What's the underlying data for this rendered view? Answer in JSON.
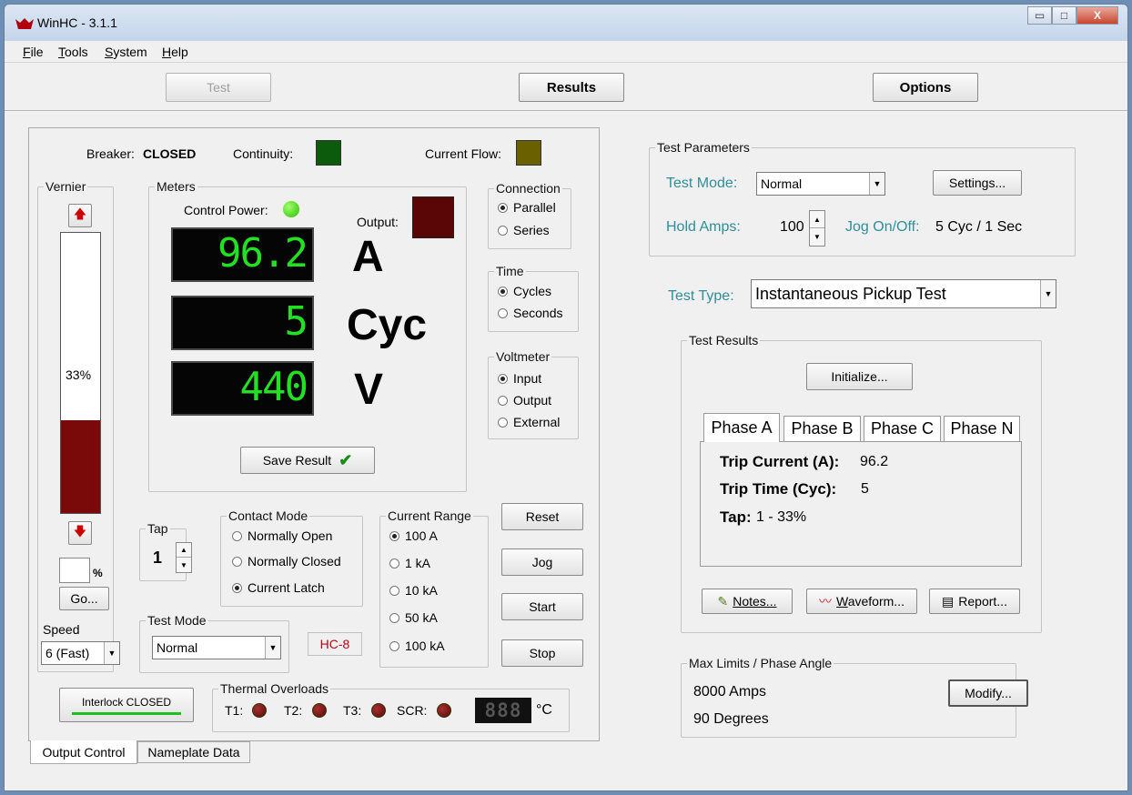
{
  "window": {
    "title": "WinHC - 3.1.1",
    "min": "▭",
    "max": "□",
    "close": "X"
  },
  "menu": {
    "items": [
      {
        "u": "F",
        "rest": "ile"
      },
      {
        "u": "T",
        "rest": "ools"
      },
      {
        "u": "S",
        "rest": "ystem"
      },
      {
        "u": "H",
        "rest": "elp"
      }
    ]
  },
  "toolbar": {
    "test": "Test",
    "results": "Results",
    "options": "Options"
  },
  "status": {
    "breaker_label": "Breaker:",
    "breaker_value": "CLOSED",
    "continuity_label": "Continuity:",
    "current_flow_label": "Current Flow:"
  },
  "vernier": {
    "label": "Vernier",
    "percent": "33%",
    "level": 0.33,
    "pct_unit": "%",
    "go": "Go...",
    "speed_label": "Speed",
    "speed_value": "6 (Fast)"
  },
  "meters": {
    "label": "Meters",
    "control_power": "Control Power:",
    "output": "Output:",
    "amps": "96.2",
    "amps_unit": "A",
    "cycles": "5",
    "cycles_unit": "Cyc",
    "volts": "440",
    "volts_unit": "V",
    "save": "Save Result"
  },
  "connection": {
    "label": "Connection",
    "options": [
      "Parallel",
      "Series"
    ]
  },
  "time": {
    "label": "Time",
    "options": [
      "Cycles",
      "Seconds"
    ]
  },
  "voltmeter": {
    "label": "Voltmeter",
    "options": [
      "Input",
      "Output",
      "External"
    ]
  },
  "tap": {
    "label": "Tap",
    "value": "1"
  },
  "contact_mode": {
    "label": "Contact Mode",
    "options": [
      "Normally Open",
      "Normally Closed",
      "Current Latch"
    ]
  },
  "current_range": {
    "label": "Current Range",
    "options": [
      "100 A",
      "1 kA",
      "10 kA",
      "50 kA",
      "100 kA"
    ]
  },
  "actions": {
    "reset": "Reset",
    "jog": "Jog",
    "start": "Start",
    "stop": "Stop"
  },
  "test_mode_left": {
    "label": "Test Mode",
    "value": "Normal",
    "model": "HC-8"
  },
  "interlock": "Interlock CLOSED",
  "thermal": {
    "label": "Thermal Overloads",
    "t1": "T1:",
    "t2": "T2:",
    "t3": "T3:",
    "scr": "SCR:",
    "display": "888",
    "unit": "°C"
  },
  "tabs_bottom": {
    "output_control": "Output Control",
    "nameplate": "Nameplate Data"
  },
  "test_params": {
    "label": "Test Parameters",
    "mode_label": "Test Mode:",
    "mode_value": "Normal",
    "settings": "Settings...",
    "hold_label": "Hold Amps:",
    "hold_value": "100",
    "jog_label": "Jog On/Off:",
    "jog_value": "5 Cyc / 1 Sec"
  },
  "test_type": {
    "label": "Test Type:",
    "value": "Instantaneous Pickup Test"
  },
  "results": {
    "label": "Test Results",
    "initialize": "Initialize...",
    "tabs": [
      "Phase A",
      "Phase B",
      "Phase C",
      "Phase N"
    ],
    "trip_current_label": "Trip Current (A):",
    "trip_current": "96.2",
    "trip_time_label": "Trip Time (Cyc):",
    "trip_time": "5",
    "tap_label": "Tap:",
    "tap": "1 - 33%",
    "notes": "Notes...",
    "waveform_u": "W",
    "waveform_rest": "aveform...",
    "report": "Report..."
  },
  "limits": {
    "label": "Max Limits / Phase Angle",
    "amps": "8000 Amps",
    "degrees": "90 Degrees",
    "modify": "Modify..."
  },
  "colors": {
    "continuity": "#0c5a0c",
    "current_flow": "#6b6000",
    "output": "#5a0606",
    "vernier_fill": "#7a0a0a",
    "lcd_green": "#22e022"
  }
}
